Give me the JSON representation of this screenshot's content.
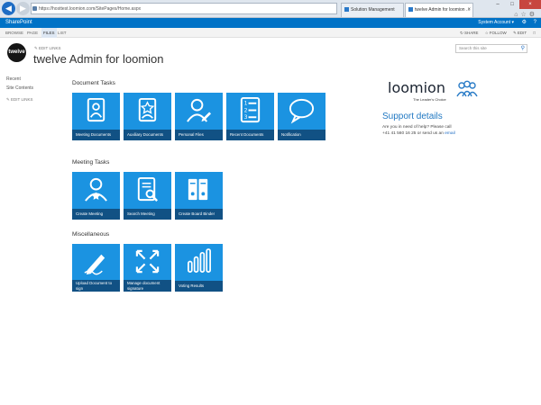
{
  "browser": {
    "url": "https://hosttest.loomion.com/SitePages/Home.aspx",
    "tabs": [
      {
        "label": "Solution Management"
      },
      {
        "label": "twelve Admin for loomion ..."
      }
    ]
  },
  "suitebar": {
    "brand": "SharePoint",
    "account": "System Account ▾"
  },
  "ribbon": {
    "tabs": [
      "BROWSE",
      "PAGE",
      "FILES",
      "LIST"
    ],
    "share": "SHARE",
    "follow": "FOLLOW",
    "edit": "EDIT"
  },
  "header": {
    "logo_text": "twelve",
    "edit_links": "EDIT LINKS",
    "title": "twelve Admin for loomion",
    "search_placeholder": "Search this site"
  },
  "leftnav": {
    "items": [
      "Recent",
      "Site Contents"
    ],
    "edit_links": "EDIT LINKS"
  },
  "sections": {
    "document_tasks": {
      "title": "Document Tasks",
      "tiles": [
        "Meeting Documents",
        "Auxiliary Documents",
        "Personal Files",
        "Recent Documents",
        "Notification"
      ]
    },
    "meeting_tasks": {
      "title": "Meeting Tasks",
      "tiles": [
        "Create Meeting",
        "Search Meeting",
        "Create Board Binder"
      ]
    },
    "miscellaneous": {
      "title": "Miscellaneous",
      "tiles": [
        "Upload Document to sign",
        "Manage document signature",
        "Voting Results"
      ]
    }
  },
  "brand_panel": {
    "logo_text": "loomion",
    "tagline": "The Leader's Choice"
  },
  "support": {
    "title": "Support details",
    "line1": "Are you in need of help? Please call",
    "phone_prefix": "+41 41 560 16 25 or send us an",
    "email_label": "email"
  },
  "colors": {
    "tile": "#1b93e1",
    "suitebar": "#0072c6",
    "link": "#1f77c2"
  }
}
